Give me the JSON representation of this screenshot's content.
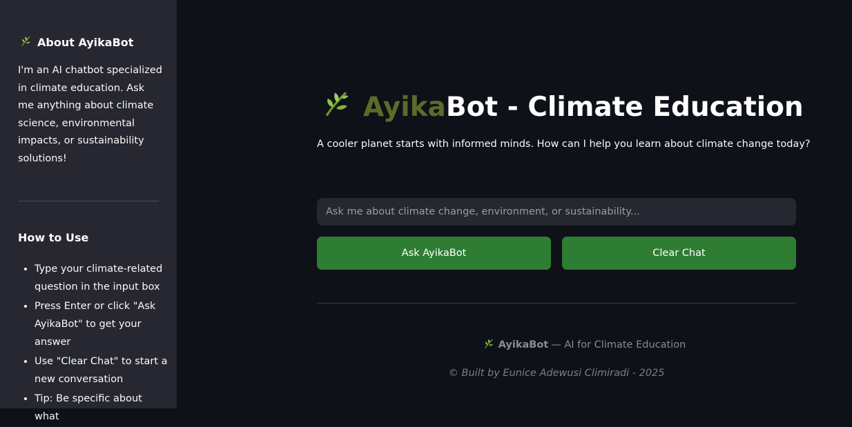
{
  "sidebar": {
    "about_title": "About AyikaBot",
    "about_text": "I'm an AI chatbot specialized in climate education. Ask me anything about climate science, environmental impacts, or sustainability solutions!",
    "howto_title": "How to Use",
    "howto_items": [
      "Type your climate-related question in the input box",
      "Press Enter or click \"Ask AyikaBot\" to get your answer",
      "Use \"Clear Chat\" to start a new conversation",
      "Tip: Be specific about what"
    ]
  },
  "main": {
    "title_ayika": "Ayika",
    "title_rest": "Bot - Climate Education",
    "subtitle": "A cooler planet starts with informed minds. How can I help you learn about climate change today?",
    "input_placeholder": "Ask me about climate change, environment, or sustainability...",
    "input_value": "",
    "ask_button": "Ask AyikaBot",
    "clear_button": "Clear Chat"
  },
  "footer": {
    "brand": "AyikaBot",
    "tagline": "— AI for Climate Education",
    "credit": "© Built by Eunice Adewusi Climiradi - 2025"
  },
  "colors": {
    "background": "#0e1117",
    "sidebar_bg": "#262730",
    "button_green": "#2e7d32",
    "title_ayika": "#5c6b2b",
    "leaf_green": "#8bc34a"
  },
  "icons": {
    "brand": "leaf-icon"
  }
}
